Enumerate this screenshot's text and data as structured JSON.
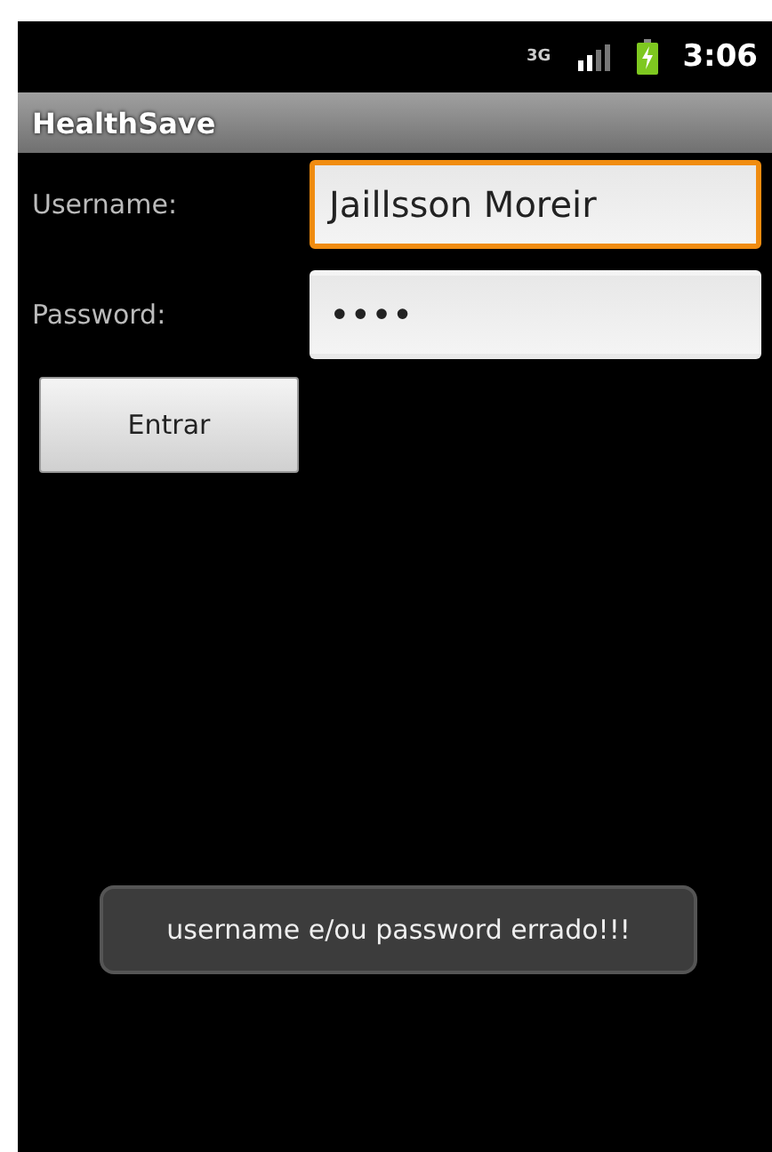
{
  "status_bar": {
    "network_type": "3G",
    "battery_charging": true,
    "time": "3:06"
  },
  "app_bar": {
    "title": "HealthSave"
  },
  "form": {
    "fields": [
      {
        "label": "Username:",
        "value": "Jaillsson Moreir",
        "focused": true
      },
      {
        "label": "Password:",
        "value": "••••",
        "focused": false
      }
    ],
    "button": "Entrar"
  },
  "toast": "username e/ou password errado!!!"
}
